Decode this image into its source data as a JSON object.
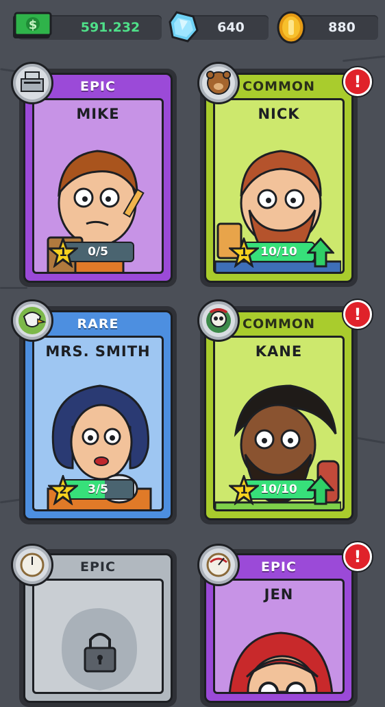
{
  "currency": {
    "cash": "591.232",
    "gems": "640",
    "coins": "880"
  },
  "cards": [
    {
      "rarity": "EPIC",
      "name": "MIKE",
      "level": "1",
      "progress_text": "0/5",
      "progress_fraction": 0.0,
      "badge_icon": "cash-register-icon",
      "alert": false,
      "upgrade": false
    },
    {
      "rarity": "COMMON",
      "name": "NICK",
      "level": "1",
      "progress_text": "10/10",
      "progress_fraction": 1.0,
      "badge_icon": "bear-icon",
      "alert": true,
      "upgrade": true
    },
    {
      "rarity": "RARE",
      "name": "MRS. SMITH",
      "level": "2",
      "progress_text": "3/5",
      "progress_fraction": 0.6,
      "badge_icon": "eagle-icon",
      "alert": false,
      "upgrade": false
    },
    {
      "rarity": "COMMON",
      "name": "KANE",
      "level": "1",
      "progress_text": "10/10",
      "progress_fraction": 1.0,
      "badge_icon": "pirate-skull-icon",
      "alert": true,
      "upgrade": true
    },
    {
      "rarity": "EPIC",
      "name": "",
      "level": "",
      "progress_text": "",
      "progress_fraction": 0.0,
      "badge_icon": "gauge-icon",
      "alert": false,
      "upgrade": false,
      "locked": true
    },
    {
      "rarity": "EPIC",
      "name": "JEN",
      "level": "",
      "progress_text": "",
      "progress_fraction": 0.0,
      "badge_icon": "pressure-gauge-icon",
      "alert": true,
      "upgrade": false
    }
  ],
  "alert_glyph": "!",
  "colors": {
    "epic": "#9b4ad8",
    "common": "#a9cc2d",
    "rare": "#4d8fe0",
    "locked": "#b1b8bf",
    "progress_fill": "#37e07a",
    "cash_text": "#4fe089"
  }
}
